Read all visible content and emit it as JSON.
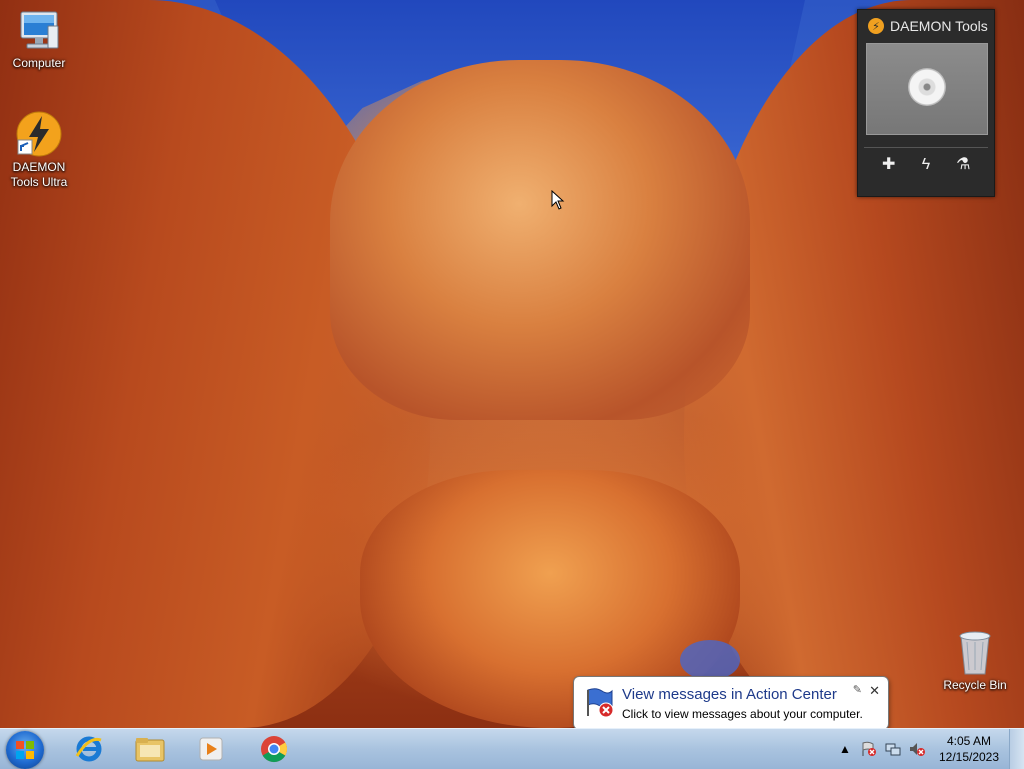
{
  "desktop": {
    "icons": [
      {
        "label": "Computer"
      },
      {
        "label": "DAEMON Tools Ultra"
      },
      {
        "label": "Recycle Bin"
      }
    ]
  },
  "gadget": {
    "title": "DAEMON Tools",
    "buttons": [
      {
        "icon": "plus-icon"
      },
      {
        "icon": "lightning-icon"
      },
      {
        "icon": "burn-icon"
      }
    ]
  },
  "taskbar": {
    "apps": [
      {
        "name": "Internet Explorer",
        "icon": "ie-icon"
      },
      {
        "name": "Windows Explorer",
        "icon": "folder-icon"
      },
      {
        "name": "Windows Media Player",
        "icon": "media-player-icon"
      },
      {
        "name": "Google Chrome",
        "icon": "chrome-icon"
      }
    ],
    "clock": {
      "time": "4:05 AM",
      "date": "12/15/2023"
    }
  },
  "notification": {
    "title": "View messages in Action Center",
    "body": "Click to view messages about your computer."
  },
  "colors": {
    "taskbar": "#a9c3df",
    "gadget_bg": "#2b2b2b",
    "daemon_orange": "#f0a020",
    "balloon_title": "#1e3a8a"
  }
}
